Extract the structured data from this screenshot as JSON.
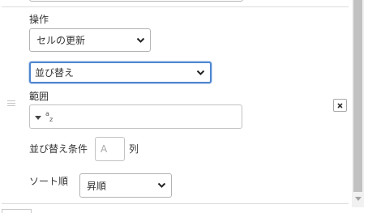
{
  "operation": {
    "label": "操作",
    "selected": "セルの更新"
  },
  "sort_type": {
    "selected": "並び替え"
  },
  "range": {
    "label": "範囲",
    "value": "",
    "icon_letters": [
      "a",
      "z"
    ]
  },
  "sort_condition": {
    "label": "並び替え条件",
    "column_placeholder": "A",
    "column_suffix": "列"
  },
  "sort_order": {
    "label": "ソート順",
    "selected": "昇順"
  },
  "icons": {
    "drag_handle": "drag-handle-icon",
    "remove": "close-icon",
    "chevron": "chevron-down-icon",
    "range_picker": "sort-az-icon"
  },
  "colors": {
    "focus_border": "#4f87cf",
    "text": "#333333",
    "placeholder": "#a9a9a9",
    "scrollbar_thumb": "#c1c1c1"
  }
}
